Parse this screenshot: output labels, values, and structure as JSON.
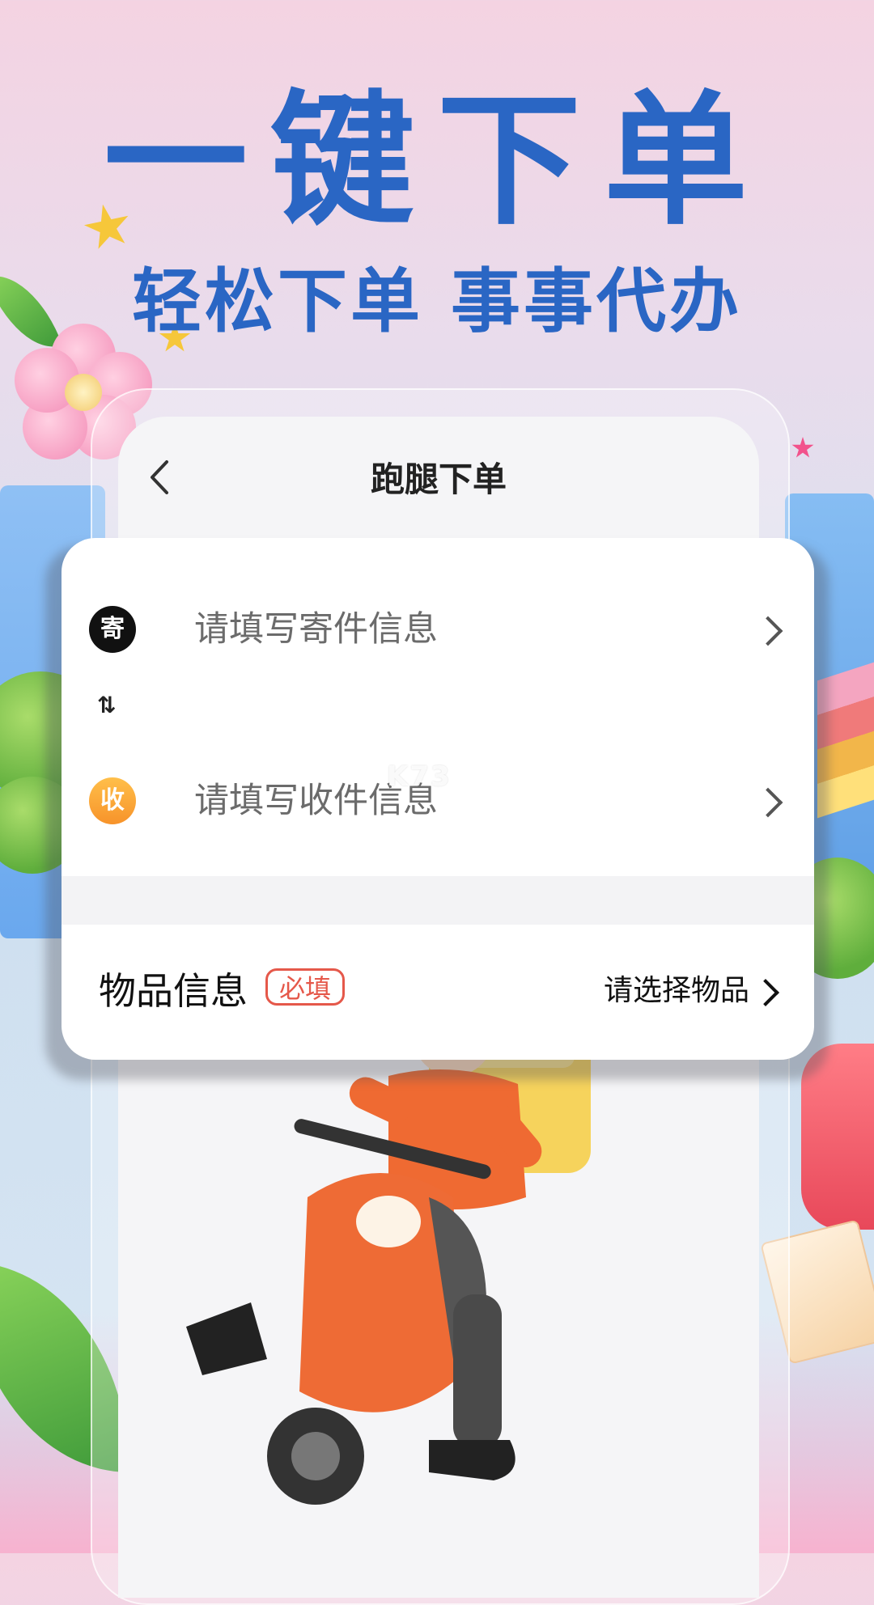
{
  "promo": {
    "headline": "一键下单",
    "subheadline": "轻松下单 事事代办"
  },
  "nav": {
    "title": "跑腿下单"
  },
  "form": {
    "sender": {
      "badge": "寄",
      "label": "请填写寄件信息"
    },
    "swap_icon": "⇅",
    "receiver": {
      "badge": "收",
      "label": "请填写收件信息"
    },
    "item": {
      "label": "物品信息",
      "required_tag": "必填",
      "select_label": "请选择物品"
    }
  },
  "watermark": "K73",
  "colors": {
    "headline": "#2a66c4",
    "required": "#e5584a",
    "receiver_badge": "#f7932a",
    "courier_orange": "#ef6a32"
  }
}
